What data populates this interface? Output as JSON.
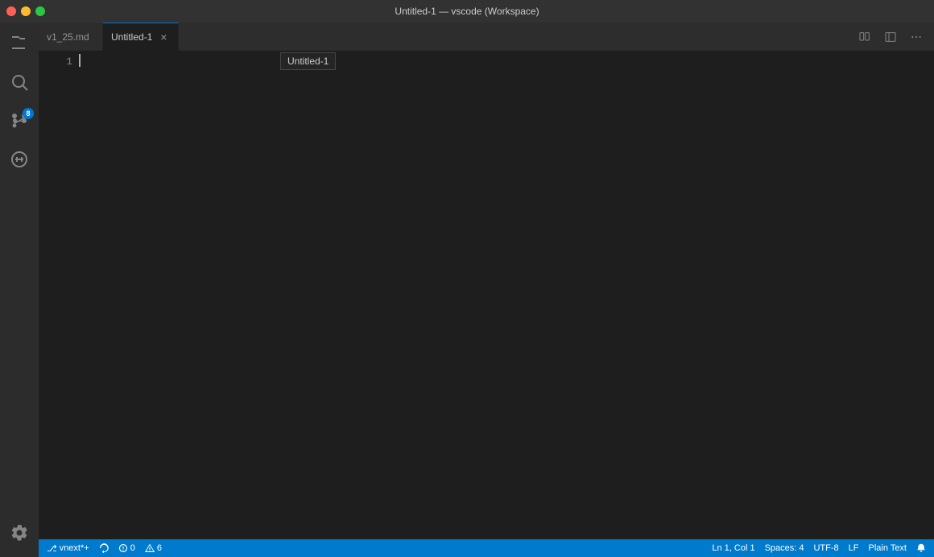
{
  "titleBar": {
    "title": "Untitled-1 — vscode (Workspace)"
  },
  "tabs": [
    {
      "id": "tab-v1",
      "label": "v1_25.md",
      "active": false,
      "closeable": false
    },
    {
      "id": "tab-untitled",
      "label": "Untitled-1",
      "active": true,
      "closeable": true
    }
  ],
  "tooltip": {
    "text": "Untitled-1"
  },
  "editor": {
    "lineNumbers": [
      "1"
    ],
    "content": ""
  },
  "activityBar": {
    "items": [
      {
        "id": "explorer",
        "icon": "files-icon",
        "label": "Explorer"
      },
      {
        "id": "search",
        "icon": "search-icon",
        "label": "Search"
      },
      {
        "id": "source-control",
        "icon": "source-control-icon",
        "label": "Source Control",
        "badge": "8"
      },
      {
        "id": "extensions",
        "icon": "extensions-icon",
        "label": "Extensions"
      }
    ],
    "bottomItems": [
      {
        "id": "settings",
        "icon": "settings-icon",
        "label": "Settings"
      }
    ]
  },
  "statusBar": {
    "left": [
      {
        "id": "branch",
        "text": "⎇ vnext*+",
        "icon": "branch-icon"
      },
      {
        "id": "sync",
        "text": "",
        "icon": "sync-icon"
      },
      {
        "id": "errors",
        "text": "⊗ 0",
        "icon": "error-icon"
      },
      {
        "id": "warnings",
        "text": "⚠ 6",
        "icon": "warning-icon"
      }
    ],
    "right": [
      {
        "id": "position",
        "text": "Ln 1, Col 1"
      },
      {
        "id": "spaces",
        "text": "Spaces: 4"
      },
      {
        "id": "encoding",
        "text": "UTF-8"
      },
      {
        "id": "eol",
        "text": "LF"
      },
      {
        "id": "language",
        "text": "Plain Text"
      },
      {
        "id": "notifications",
        "icon": "bell-icon",
        "text": ""
      }
    ]
  }
}
